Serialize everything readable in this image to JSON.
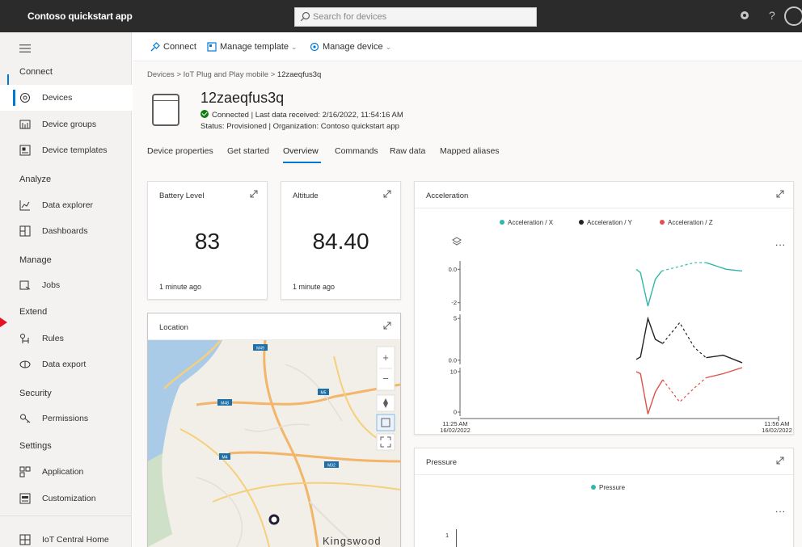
{
  "header": {
    "app_title": "Contoso quickstart app",
    "search_placeholder": "Search for devices",
    "help": "?"
  },
  "sidebar": {
    "groups": [
      {
        "heading": "Connect",
        "items": [
          {
            "label": "Devices",
            "icon": "devices-icon",
            "active": true
          },
          {
            "label": "Device groups",
            "icon": "device-groups-icon"
          },
          {
            "label": "Device templates",
            "icon": "device-templates-icon"
          }
        ]
      },
      {
        "heading": "Analyze",
        "items": [
          {
            "label": "Data explorer",
            "icon": "data-explorer-icon"
          },
          {
            "label": "Dashboards",
            "icon": "dashboards-icon"
          }
        ]
      },
      {
        "heading": "Manage",
        "items": [
          {
            "label": "Jobs",
            "icon": "jobs-icon"
          }
        ]
      },
      {
        "heading": "Extend",
        "items": [
          {
            "label": "Rules",
            "icon": "rules-icon"
          },
          {
            "label": "Data export",
            "icon": "data-export-icon"
          }
        ]
      },
      {
        "heading": "Security",
        "items": [
          {
            "label": "Permissions",
            "icon": "permissions-icon"
          }
        ]
      },
      {
        "heading": "Settings",
        "items": [
          {
            "label": "Application",
            "icon": "application-icon"
          },
          {
            "label": "Customization",
            "icon": "customization-icon"
          }
        ]
      }
    ],
    "footer_item": {
      "label": "IoT Central Home",
      "icon": "iot-central-home-icon"
    }
  },
  "commandbar": {
    "connect": "Connect",
    "manage_template": "Manage template",
    "manage_device": "Manage device"
  },
  "breadcrumb": {
    "part1": "Devices",
    "part2": "IoT Plug and Play mobile",
    "part3": "12zaeqfus3q"
  },
  "device": {
    "name": "12zaeqfus3q",
    "status_line": "Connected | Last data received: 2/16/2022, 11:54:16 AM",
    "status_line2": "Status: Provisioned | Organization: Contoso quickstart app"
  },
  "tabs": [
    {
      "label": "Device properties"
    },
    {
      "label": "Get started"
    },
    {
      "label": "Overview",
      "active": true
    },
    {
      "label": "Commands"
    },
    {
      "label": "Raw data"
    },
    {
      "label": "Mapped aliases"
    }
  ],
  "tiles": {
    "battery": {
      "title": "Battery Level",
      "value": "83",
      "ago": "1 minute ago"
    },
    "altitude": {
      "title": "Altitude",
      "value": "84.40",
      "ago": "1 minute ago"
    },
    "location": {
      "title": "Location",
      "map_label": "Kingswood",
      "road_labels": [
        "M49",
        "M48",
        "M5",
        "M4",
        "M32"
      ],
      "zoom_in": "+",
      "zoom_out": "−"
    },
    "acceleration": {
      "title": "Acceleration",
      "more": "..."
    },
    "pressure": {
      "title": "Pressure",
      "more": "..."
    }
  },
  "colors": {
    "accent": "#0078d4",
    "accel_x": "#2fb8a8",
    "accel_y": "#222222",
    "accel_z": "#e0504a",
    "pressure": "#2fb8a8",
    "topbar": "#2b2b2b"
  },
  "chart_data": [
    {
      "type": "line",
      "title": "Acceleration",
      "x_ticks": [
        {
          "time": "11:25 AM",
          "date": "16/02/2022"
        },
        {
          "time": "11:56 AM",
          "date": "16/02/2022"
        }
      ],
      "series": [
        {
          "name": "Acceleration / X",
          "y_ticks": [
            "0.0",
            "-2"
          ],
          "y_range": [
            -2.5,
            0.5
          ],
          "points": [
            [
              0.0,
              0.0
            ],
            [
              0.04,
              -0.2
            ],
            [
              0.11,
              -2.2
            ],
            [
              0.18,
              -0.6
            ],
            [
              0.24,
              -0.1
            ],
            [
              0.55,
              0.4
            ],
            [
              0.66,
              0.4
            ],
            [
              0.85,
              0.0
            ],
            [
              1.0,
              -0.1
            ]
          ]
        },
        {
          "name": "Acceleration / Y",
          "y_ticks": [
            "5",
            "0.0"
          ],
          "y_range": [
            -0.5,
            5.5
          ],
          "points": [
            [
              0.0,
              0.1
            ],
            [
              0.04,
              0.4
            ],
            [
              0.11,
              5.0
            ],
            [
              0.18,
              2.5
            ],
            [
              0.25,
              2.0
            ],
            [
              0.41,
              4.5
            ],
            [
              0.55,
              1.5
            ],
            [
              0.66,
              0.3
            ],
            [
              0.82,
              0.6
            ],
            [
              1.0,
              -0.3
            ]
          ]
        },
        {
          "name": "Acceleration / Z",
          "y_ticks": [
            "10",
            "0"
          ],
          "y_range": [
            -1,
            11
          ],
          "points": [
            [
              0.0,
              10.0
            ],
            [
              0.04,
              9.5
            ],
            [
              0.11,
              -0.5
            ],
            [
              0.18,
              5.0
            ],
            [
              0.25,
              8.0
            ],
            [
              0.41,
              2.5
            ],
            [
              0.55,
              6.0
            ],
            [
              0.66,
              8.5
            ],
            [
              0.82,
              9.5
            ],
            [
              1.0,
              11.0
            ]
          ]
        }
      ]
    },
    {
      "type": "line",
      "title": "Pressure",
      "series": [
        {
          "name": "Pressure",
          "y_ticks": [
            "1"
          ],
          "values": []
        }
      ]
    }
  ]
}
